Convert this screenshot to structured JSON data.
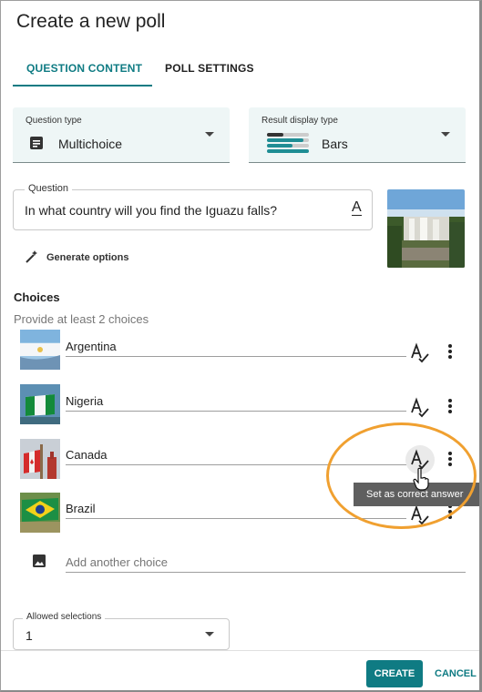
{
  "dialog": {
    "title": "Create a new poll"
  },
  "tabs": [
    {
      "label": "QUESTION CONTENT",
      "active": true
    },
    {
      "label": "POLL SETTINGS",
      "active": false
    }
  ],
  "question_type": {
    "label": "Question type",
    "value": "Multichoice",
    "icon": "list-doc-icon"
  },
  "result_display": {
    "label": "Result display type",
    "value": "Bars",
    "icon": "bars-icon"
  },
  "question": {
    "label": "Question",
    "value": "In what country will you find the Iguazu falls?",
    "image": "waterfall-photo"
  },
  "generate_options": {
    "label": "Generate options",
    "icon": "magic-wand-icon"
  },
  "choices_section": {
    "heading": "Choices",
    "hint": "Provide at least 2 choices"
  },
  "choices": [
    {
      "label": "Argentina",
      "image": "flag-argentina"
    },
    {
      "label": "Nigeria",
      "image": "flag-nigeria"
    },
    {
      "label": "Canada",
      "image": "flag-canada"
    },
    {
      "label": "Brazil",
      "image": "flag-brazil"
    }
  ],
  "add_choice": {
    "placeholder": "Add another choice",
    "icon": "image-icon"
  },
  "tooltip": {
    "text": "Set as correct answer"
  },
  "allowed_selections": {
    "label": "Allowed selections",
    "value": "1"
  },
  "footer": {
    "create_label": "CREATE",
    "cancel_label": "CANCEL"
  },
  "colors": {
    "accent": "#0f7b83",
    "highlight": "#f0a030",
    "field_bg": "#eef6f6"
  }
}
